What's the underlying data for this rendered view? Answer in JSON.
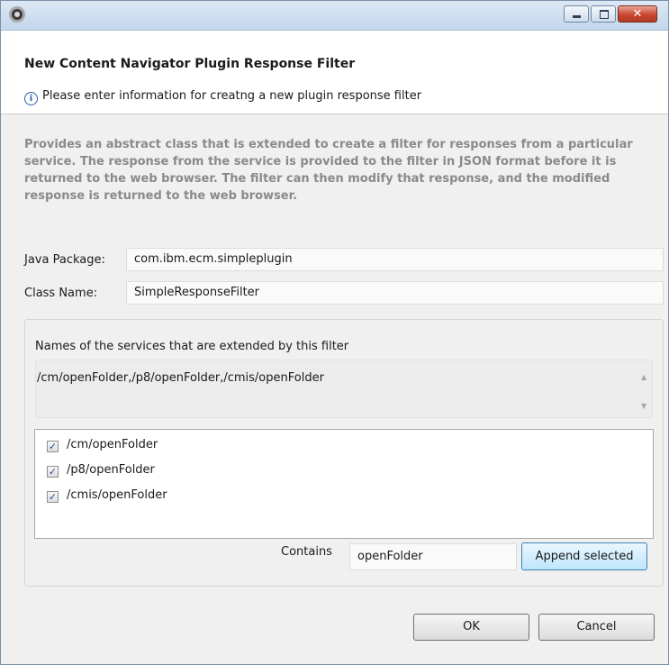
{
  "window": {
    "title": "",
    "controls": {
      "minimize": "minimize",
      "maximize": "maximize",
      "close": "✕"
    }
  },
  "header": {
    "title": "New Content Navigator Plugin Response Filter",
    "info_icon": "info-circle-icon",
    "info_text": "Please enter information for creatng a new plugin response filter"
  },
  "description": "Provides an abstract class that is extended to create a filter for responses from a particular service. The response from the service is provided to the filter in JSON format before it is returned to the web browser. The filter can then modify that response, and the modified response is returned to the web browser.",
  "form": {
    "java_package_label": "Java Package:",
    "java_package_value": "com.ibm.ecm.simpleplugin",
    "class_name_label": "Class Name:",
    "class_name_value": "SimpleResponseFilter"
  },
  "services": {
    "label": "Names of the services that are extended by this filter",
    "value": "/cm/openFolder,/p8/openFolder,/cmis/openFolder",
    "items": [
      {
        "label": "/cm/openFolder",
        "checked": true
      },
      {
        "label": "/p8/openFolder",
        "checked": true
      },
      {
        "label": "/cmis/openFolder",
        "checked": true
      }
    ],
    "contains_label": "Contains",
    "contains_value": "openFolder",
    "append_button": "Append selected"
  },
  "buttons": {
    "ok": "OK",
    "cancel": "Cancel"
  },
  "colors": {
    "accent": "#3c7fb1",
    "description_text": "#8a8a8a",
    "close_button": "#c9462f"
  }
}
